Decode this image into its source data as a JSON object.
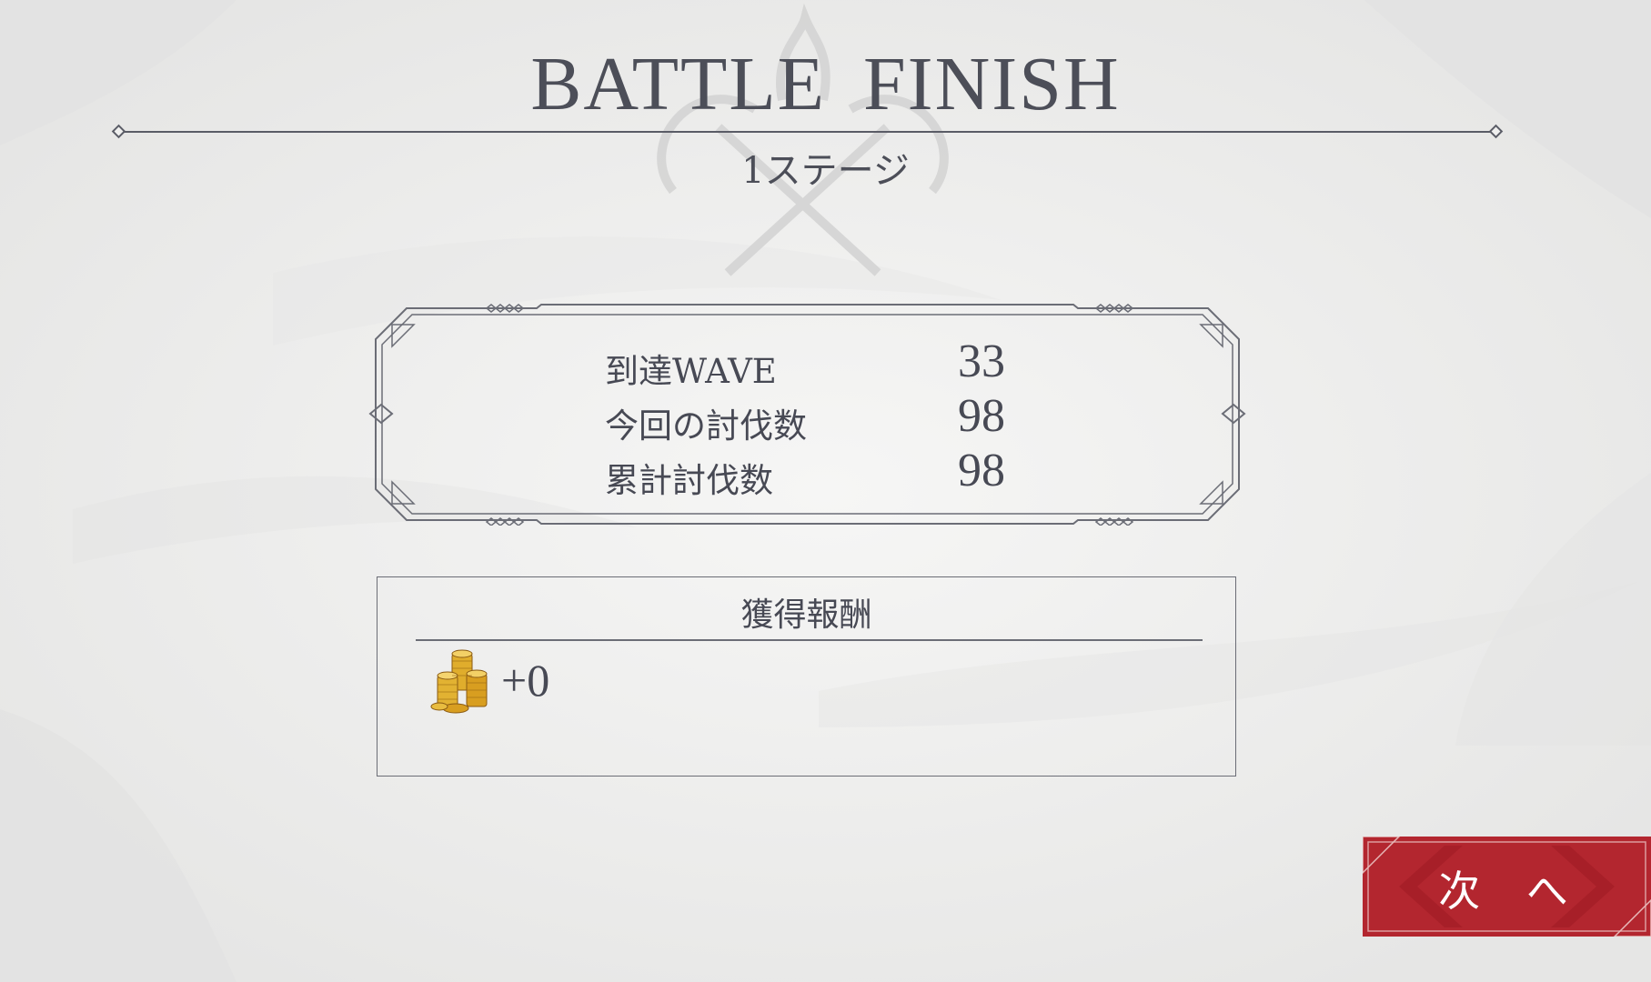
{
  "title": "BATTLE  FINISH",
  "stage": "1ステージ",
  "stats": [
    {
      "label": "到達WAVE",
      "value": "33"
    },
    {
      "label": "今回の討伐数",
      "value": "98"
    },
    {
      "label": "累計討伐数",
      "value": "98"
    }
  ],
  "reward": {
    "title": "獲得報酬",
    "items": [
      {
        "icon": "gold-coins-icon",
        "amount": "+0"
      }
    ]
  },
  "next_button": {
    "label": "次 へ"
  },
  "colors": {
    "background": "#efefee",
    "text": "#4a4c56",
    "frame": "#6b6d76",
    "button": "#b3262f",
    "coin": "#d9a323"
  }
}
